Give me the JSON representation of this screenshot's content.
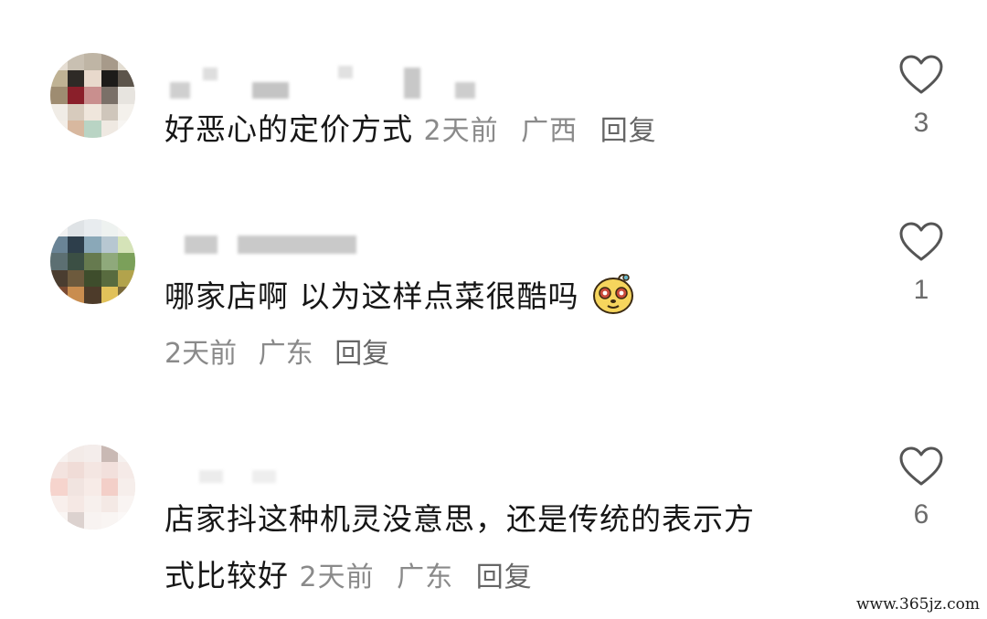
{
  "comments": [
    {
      "text": "好恶心的定价方式",
      "time": "2天前",
      "location": "广西",
      "reply_label": "回复",
      "likes": "3",
      "emoji": null
    },
    {
      "text": "哪家店啊 以为这样点菜很酷吗",
      "time": "2天前",
      "location": "广东",
      "reply_label": "回复",
      "likes": "1",
      "emoji": "meerkat-sticker-icon"
    },
    {
      "text_line1": "店家抖这种机灵没意思，还是传统的表示方",
      "text_line2": "式比较好",
      "time": "2天前",
      "location": "广东",
      "reply_label": "回复",
      "likes": "6",
      "emoji": null
    }
  ],
  "icons": {
    "like": "heart-outline-icon"
  },
  "colors": {
    "text": "#161616",
    "meta": "#8a8a8a",
    "icon": "#555555"
  },
  "watermark": "www.365jz.com"
}
